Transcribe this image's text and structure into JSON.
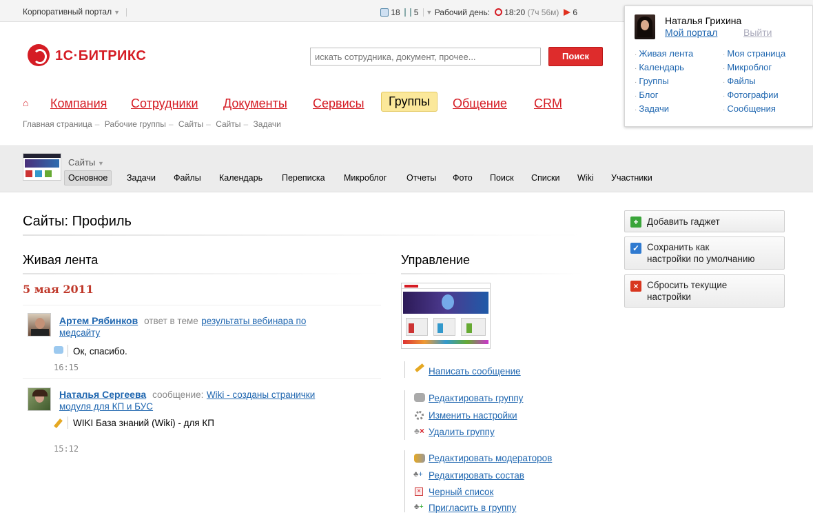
{
  "topbar": {
    "portal_label": "Корпоративный портал",
    "stat1": "18",
    "stat2": "5",
    "workday_label": "Рабочий день:",
    "workday_time": "18:20",
    "workday_elapsed": "(7ч 56м)",
    "flags": "6"
  },
  "user": {
    "name": "Наталья Грихина",
    "my_portal": "Мой портал",
    "logout": "Выйти",
    "links_left": [
      "Живая лента",
      "Календарь",
      "Группы",
      "Блог",
      "Задачи"
    ],
    "links_right": [
      "Моя страница",
      "Микроблог",
      "Файлы",
      "Фотографии",
      "Сообщения"
    ]
  },
  "logo": {
    "text": "1С·БИТРИКС"
  },
  "search": {
    "placeholder": "искать сотрудника, документ, прочее...",
    "button": "Поиск"
  },
  "nav": {
    "items": [
      "Компания",
      "Сотрудники",
      "Документы",
      "Сервисы",
      "Группы",
      "Общение",
      "CRM"
    ],
    "active": "Группы"
  },
  "breadcrumbs": [
    "Главная страница",
    "Рабочие группы",
    "Сайты",
    "Сайты",
    "Задачи"
  ],
  "group": {
    "name": "Сайты",
    "tabs": [
      "Основное",
      "Задачи",
      "Файлы",
      "Календарь",
      "Переписка",
      "Микроблог",
      "Отчеты",
      "Фото",
      "Поиск",
      "Списки",
      "Wiki",
      "Участники"
    ],
    "active_tab": "Основное"
  },
  "page": {
    "title": "Сайты: Профиль"
  },
  "feed": {
    "title": "Живая лента",
    "date": "5 мая 2011",
    "entries": [
      {
        "author": "Артем Рябинков",
        "verb": "ответ в теме",
        "topic_line1": "результаты вебинара по",
        "topic_line2": "медсайту",
        "body": "Ок, спасибо.",
        "time": "16:15"
      },
      {
        "author": "Наталья Сергеева",
        "verb": "сообщение:",
        "topic_line1": "Wiki - созданы странички",
        "topic_line2": "модуля для КП и БУС",
        "body": "WIKI База знаний (Wiki) - для КП",
        "time": "15:12"
      }
    ]
  },
  "manage": {
    "title": "Управление",
    "write": "Написать сообщение",
    "edit_group": "Редактировать группу",
    "change_settings": "Изменить настройки",
    "delete_group": "Удалить группу",
    "edit_moderators": "Редактировать модераторов",
    "edit_members": "Редактировать состав",
    "blacklist": "Черный список",
    "invite": "Пригласить в группу"
  },
  "gadgets": {
    "add": "Добавить гаджет",
    "save_line1": "Сохранить как",
    "save_line2": "настройки по умолчанию",
    "reset_line1": "Сбросить текущие",
    "reset_line2": "настройки"
  },
  "colors": {
    "accent": "#d51c24",
    "link": "#2067b0",
    "active_nav": "#fbe89a"
  }
}
